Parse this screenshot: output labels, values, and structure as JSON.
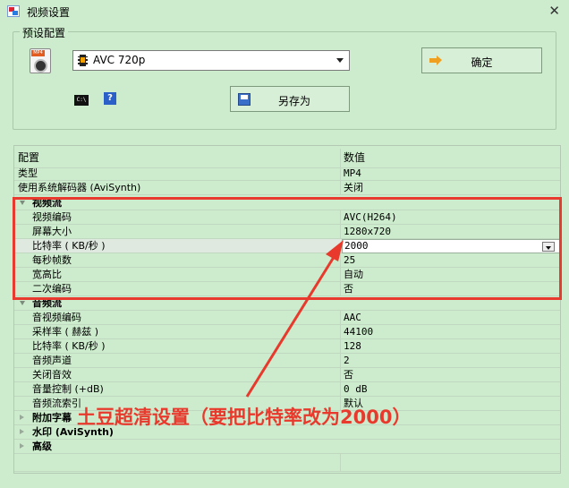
{
  "window": {
    "title": "视频设置",
    "close_glyph": "✕"
  },
  "preset": {
    "group_label": "预设配置",
    "mp4_icon_tag": "MP4",
    "selected": "AVC 720p",
    "ok_label": "确定",
    "saveas_label": "另存为",
    "cmd_icon_text": "C:\\",
    "help_icon_text": "?"
  },
  "grid": {
    "headers": {
      "name": "配置",
      "value": "数值"
    },
    "rows": [
      {
        "name": "类型",
        "value": "MP4"
      },
      {
        "name": "使用系统解码器 (AviSynth)",
        "value": "关闭"
      }
    ],
    "video_stream": {
      "label": "视频流",
      "rows": [
        {
          "name": "视频编码",
          "value": "AVC(H264)"
        },
        {
          "name": "屏幕大小",
          "value": "1280x720"
        },
        {
          "name": "比特率 ( KB/秒 )",
          "value": "2000"
        },
        {
          "name": "每秒帧数",
          "value": "25"
        },
        {
          "name": "宽高比",
          "value": "自动"
        },
        {
          "name": "二次编码",
          "value": "否"
        }
      ]
    },
    "audio_stream": {
      "label": "音频流",
      "rows": [
        {
          "name": "音视频编码",
          "value": "AAC"
        },
        {
          "name": "采样率 ( 赫兹 )",
          "value": "44100"
        },
        {
          "name": "比特率 ( KB/秒 )",
          "value": "128"
        },
        {
          "name": "音频声道",
          "value": "2"
        },
        {
          "name": "关闭音效",
          "value": "否"
        },
        {
          "name": "音量控制 (+dB)",
          "value": "0 dB"
        },
        {
          "name": "音频流索引",
          "value": "默认"
        }
      ]
    },
    "collapsed_categories": [
      "附加字幕",
      "水印 (AviSynth)",
      "高级"
    ]
  },
  "annotation": {
    "text": "土豆超清设置（要把比特率改为2000）",
    "color": "#e8392c"
  }
}
